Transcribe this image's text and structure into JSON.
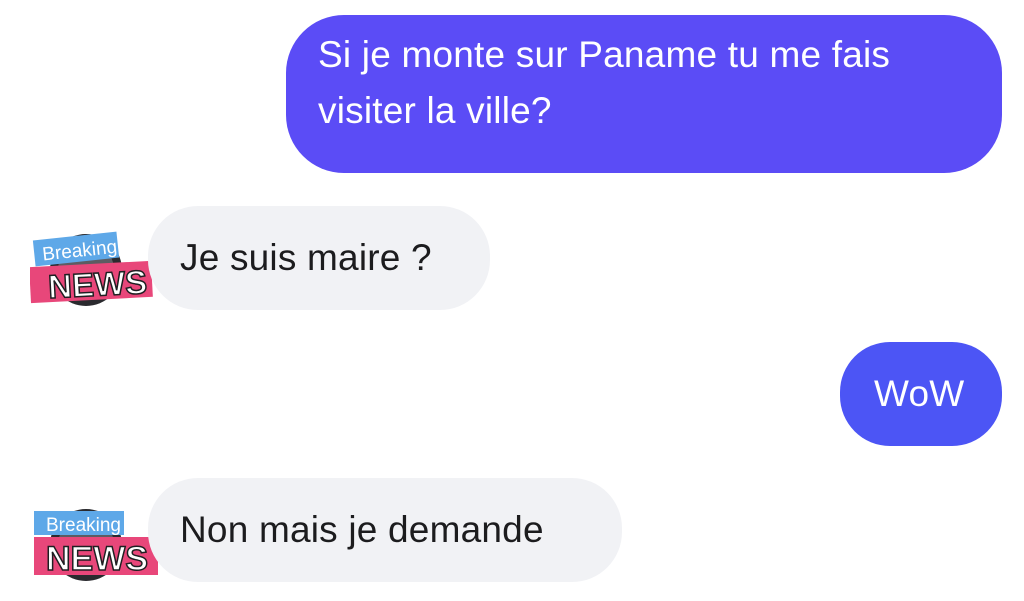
{
  "conversation": {
    "messages": [
      {
        "sender": "me",
        "text": "Si je monte sur Paname tu me fais visiter la ville?"
      },
      {
        "sender": "contact",
        "text": "Je suis maire ?"
      },
      {
        "sender": "me",
        "text": "WoW"
      },
      {
        "sender": "contact",
        "text": "Non mais je demande"
      }
    ]
  },
  "contact": {
    "avatar_text_top": "Breaking",
    "avatar_text_bottom": "NEWS"
  },
  "colors": {
    "sent_bubble": "#5b4cf6",
    "sent_bubble_short": "#4c55f5",
    "received_bubble": "#f1f2f5",
    "badge_blue": "#5ea8e8",
    "badge_pink": "#e8477a"
  }
}
